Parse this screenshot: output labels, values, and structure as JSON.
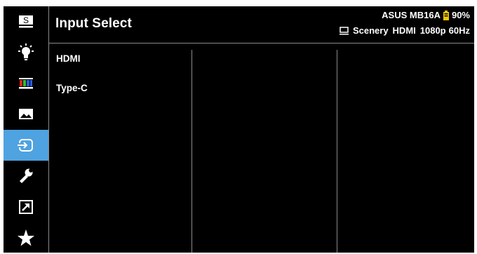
{
  "header": {
    "title": "Input Select",
    "model": "ASUS MB16A",
    "battery_percent": "90%",
    "battery_icon": "battery-icon",
    "status_icon": "monitor-icon",
    "mode": "Scenery",
    "input": "HDMI",
    "resolution": "1080p",
    "refresh": "60Hz"
  },
  "sidebar": {
    "items": [
      {
        "icon": "splendid-s-icon"
      },
      {
        "icon": "blue-light-bulb-icon"
      },
      {
        "icon": "color-bars-icon"
      },
      {
        "icon": "image-icon"
      },
      {
        "icon": "input-select-icon",
        "active": true
      },
      {
        "icon": "wrench-icon"
      },
      {
        "icon": "shortcut-arrow-icon"
      },
      {
        "icon": "star-icon"
      }
    ]
  },
  "options": [
    "HDMI",
    "Type-C"
  ],
  "colors": {
    "background": "#000000",
    "active": "#4fa3e0",
    "battery": "#f2c300",
    "divider": "#8a8a8a"
  }
}
